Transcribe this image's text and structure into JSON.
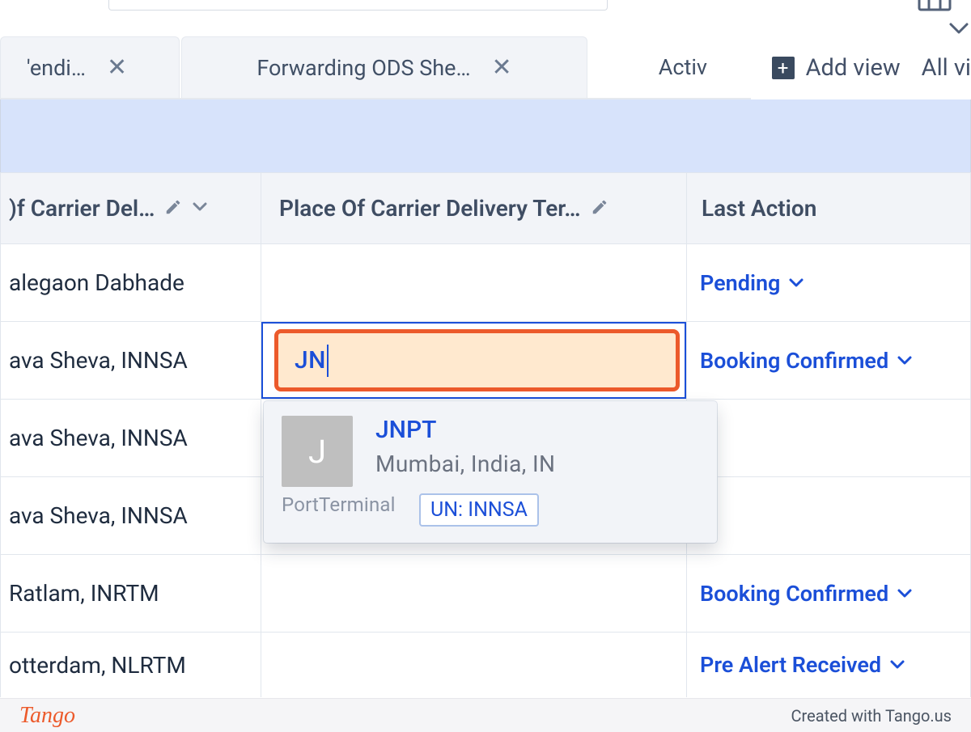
{
  "tabs": [
    {
      "label": "'endi…",
      "active": false
    },
    {
      "label": "Forwarding ODS She…",
      "active": false
    },
    {
      "label": "Activ",
      "active": true
    }
  ],
  "add_view_label": "Add view",
  "all_views_label": "All vi",
  "columns": {
    "col1": ")f Carrier Del…",
    "col2": "Place Of Carrier Delivery Ter…",
    "col3": "Last Action"
  },
  "rows": [
    {
      "c1": "alegaon Dabhade",
      "c2": "",
      "c3": "Pending"
    },
    {
      "c1": "ava Sheva, INNSA",
      "c2_input": "JN",
      "c3": "Booking Confirmed",
      "editing": true
    },
    {
      "c1": "ava Sheva, INNSA",
      "c2": "",
      "c3": ""
    },
    {
      "c1": "ava Sheva, INNSA",
      "c2": "",
      "c3": ""
    },
    {
      "c1": "Ratlam, INRTM",
      "c2": "",
      "c3": "Booking Confirmed"
    },
    {
      "c1": "otterdam, NLRTM",
      "c2": "",
      "c3": "Pre Alert Received"
    }
  ],
  "autocomplete": {
    "avatar_letter": "J",
    "title": "JNPT",
    "subtitle": "Mumbai, India, IN",
    "type_label": "PortTerminal",
    "code_badge": "UN: INNSA"
  },
  "footer": {
    "brand": "Tango",
    "credit": "Created with Tango.us"
  }
}
